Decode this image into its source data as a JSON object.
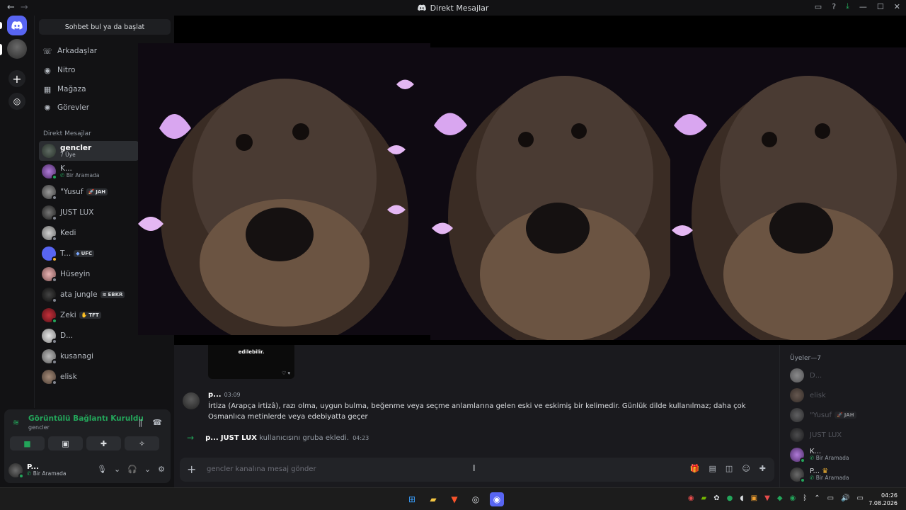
{
  "window": {
    "title": "Direkt Mesajlar",
    "nav_back": "←",
    "nav_forward": "→"
  },
  "sidebar": {
    "search_label": "Sohbet bul ya da başlat",
    "nav": [
      {
        "label": "Arkadaşlar",
        "icon": "friends-icon"
      },
      {
        "label": "Nitro",
        "icon": "nitro-icon"
      },
      {
        "label": "Mağaza",
        "icon": "shop-icon"
      },
      {
        "label": "Görevler",
        "icon": "quests-icon"
      }
    ],
    "dm_header": "Direkt Mesajlar",
    "dms": [
      {
        "name": "gencler",
        "sub": "7 Üye",
        "active": true,
        "status": "none",
        "tag": ""
      },
      {
        "name": "K...",
        "sub": "Bir Aramada",
        "active": false,
        "status": "on",
        "tag": ""
      },
      {
        "name": "\"Yusuf",
        "sub": "",
        "active": false,
        "status": "off",
        "tag": "JAH"
      },
      {
        "name": "JUST LUX",
        "sub": "",
        "active": false,
        "status": "off",
        "tag": ""
      },
      {
        "name": "Kedi",
        "sub": "",
        "active": false,
        "status": "off",
        "tag": ""
      },
      {
        "name": "T...",
        "sub": "",
        "active": false,
        "status": "idle",
        "tag": "UFC"
      },
      {
        "name": "Hüseyin",
        "sub": "",
        "active": false,
        "status": "off",
        "tag": ""
      },
      {
        "name": "ata jungle",
        "sub": "",
        "active": false,
        "status": "off",
        "tag": "EBKR"
      },
      {
        "name": "Zeki",
        "sub": "",
        "active": false,
        "status": "on",
        "tag": "TFT"
      },
      {
        "name": "D...",
        "sub": "",
        "active": false,
        "status": "off",
        "tag": ""
      },
      {
        "name": "kusanagi",
        "sub": "",
        "active": false,
        "status": "off",
        "tag": ""
      },
      {
        "name": "elisk",
        "sub": "",
        "active": false,
        "status": "off",
        "tag": ""
      }
    ]
  },
  "voice": {
    "status": "Görüntülü Bağlantı Kuruldu",
    "channel": "gencler"
  },
  "me": {
    "name": "P...",
    "status": "Bir Aramada"
  },
  "chat": {
    "sticker_text": "edilebilir. edilebilir. edilebilir. edilebilir. edilebilir. edilebilir. edilebilir. edilebilir. edilebilir. edilebilir. edilebilir. edilebilir. edilebilir. edilebilir. edilebilir. edilebilir. edilebilir. edilebilir. edilebilir. edilebilir. edilebilir. edilebilir. edilebilir. edilebilir. edilebilir. edilebilir. edilebilir. edilebilir. edilebilir. edilebilir. edilebilir. edilebilir. edilebilir. edilebilir. edilebilir. edilebilir. edilebilir. edilebilir.",
    "message": {
      "author": "p...",
      "time": "03:09",
      "text": "İrtiza (Arapça irtizâ), razı olma, uygun bulma, beğenme veya seçme anlamlarına gelen eski ve eskimiş bir kelimedir. Günlük dilde kullanılmaz; daha çok Osmanlıca metinlerde veya edebiyatta geçer"
    },
    "system": {
      "actor": "p...",
      "target": "JUST LUX",
      "text": "kullanıcısını gruba ekledi.",
      "time": "04:23"
    },
    "composer_placeholder": "gencler kanalına mesaj gönder"
  },
  "members": {
    "header": "Üyeler—7",
    "list": [
      {
        "name": "D...",
        "sub": "",
        "online": false,
        "tag": ""
      },
      {
        "name": "elisk",
        "sub": "",
        "online": false,
        "tag": ""
      },
      {
        "name": "\"Yusuf",
        "sub": "",
        "online": false,
        "tag": "JAH"
      },
      {
        "name": "JUST LUX",
        "sub": "",
        "online": false,
        "tag": ""
      },
      {
        "name": "K...",
        "sub": "Bir Aramada",
        "online": true,
        "tag": ""
      },
      {
        "name": "P...",
        "sub": "Bir Aramada",
        "online": true,
        "tag": ""
      }
    ]
  },
  "taskbar": {
    "time": "04:26",
    "date": "7.08.2026"
  },
  "colors": {
    "accent": "#5865f2",
    "online": "#23a55a",
    "background": "#121214"
  }
}
